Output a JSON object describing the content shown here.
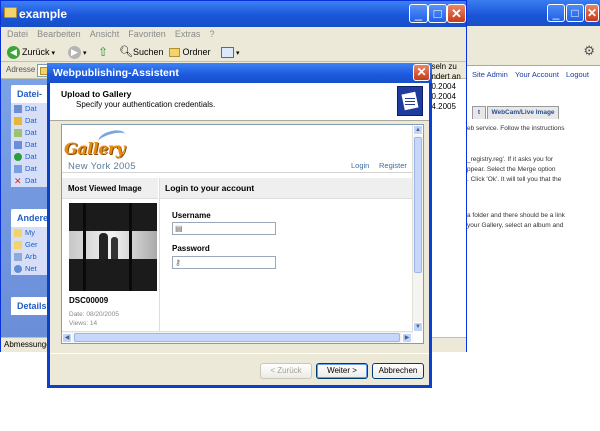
{
  "background_browser": {
    "nav_links": [
      "Site Admin",
      "Your Account",
      "Logout"
    ],
    "tabs": [
      "t",
      "WebCam/Live Image"
    ],
    "text_lines": [
      "eb service. Follow the instructions",
      "_registry.reg'. If it asks you for",
      "ppear. Select the Merge option",
      ". Click 'Ok'. It will tell you that the",
      "a folder and there should be a link",
      " your Gallery, select an album and"
    ]
  },
  "explorer": {
    "title": "example",
    "menu": [
      "Datei",
      "Bearbeiten",
      "Ansicht",
      "Favoriten",
      "Extras",
      "?"
    ],
    "toolbar": {
      "back": "Zurück",
      "search": "Suchen",
      "folders": "Ordner"
    },
    "address_label": "Adresse",
    "left_pane": {
      "tasks_header": "Datei-",
      "task_items": [
        "Dat",
        "Dat",
        "Dat",
        "Dat",
        "Dat",
        "Dat",
        "Dat"
      ],
      "other_header": "Andere",
      "other_items": [
        "My",
        "Ger",
        "Arb",
        "Net"
      ],
      "details_header": "Details"
    },
    "right_info": [
      "hseln zu",
      "ändert an",
      "10.2004",
      "10.2004",
      "04.2005"
    ],
    "status_text": "Abmessunge"
  },
  "wizard": {
    "title": "Webpublishing-Assistent",
    "header_title": "Upload to Gallery",
    "header_subtitle": "Specify your authentication credentials.",
    "buttons": {
      "back": "< Zurück",
      "next": "Weiter >",
      "cancel": "Abbrechen"
    }
  },
  "gallery_page": {
    "logo": "Gallery",
    "album_title": "New York 2005",
    "links": {
      "login": "Login",
      "register": "Register"
    },
    "sidebar_heading": "Most Viewed Image",
    "photo_name": "DSC00009",
    "photo_date": "Date: 08/20/2005",
    "photo_views": "Views: 14",
    "login_heading": "Login to your account",
    "username_label": "Username",
    "password_label": "Password",
    "username_value": "",
    "password_value": ""
  }
}
